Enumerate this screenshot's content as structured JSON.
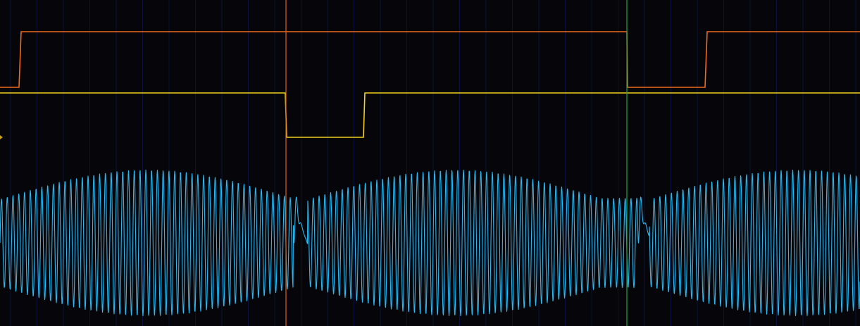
{
  "colors": {
    "background": "#05050a",
    "grid_major": "#14206a",
    "grid_minor": "#0c1238",
    "channel_orange": "#f06a1e",
    "channel_yellow": "#f2d21a",
    "channel_cyan": "#2ab8f0",
    "cursor_a": "#e06018",
    "cursor_b": "#1aa84a",
    "marker": "#c8a020"
  },
  "channels": [
    {
      "id": "orange",
      "name": "",
      "color_key": "channel_orange"
    },
    {
      "id": "yellow",
      "name": "",
      "color_key": "channel_yellow"
    },
    {
      "id": "cyan",
      "name": "",
      "color_key": "channel_cyan"
    }
  ],
  "cursors": [
    {
      "id": "cursor-a",
      "color_key": "cursor_a"
    },
    {
      "id": "cursor-b",
      "color_key": "cursor_b"
    }
  ]
}
